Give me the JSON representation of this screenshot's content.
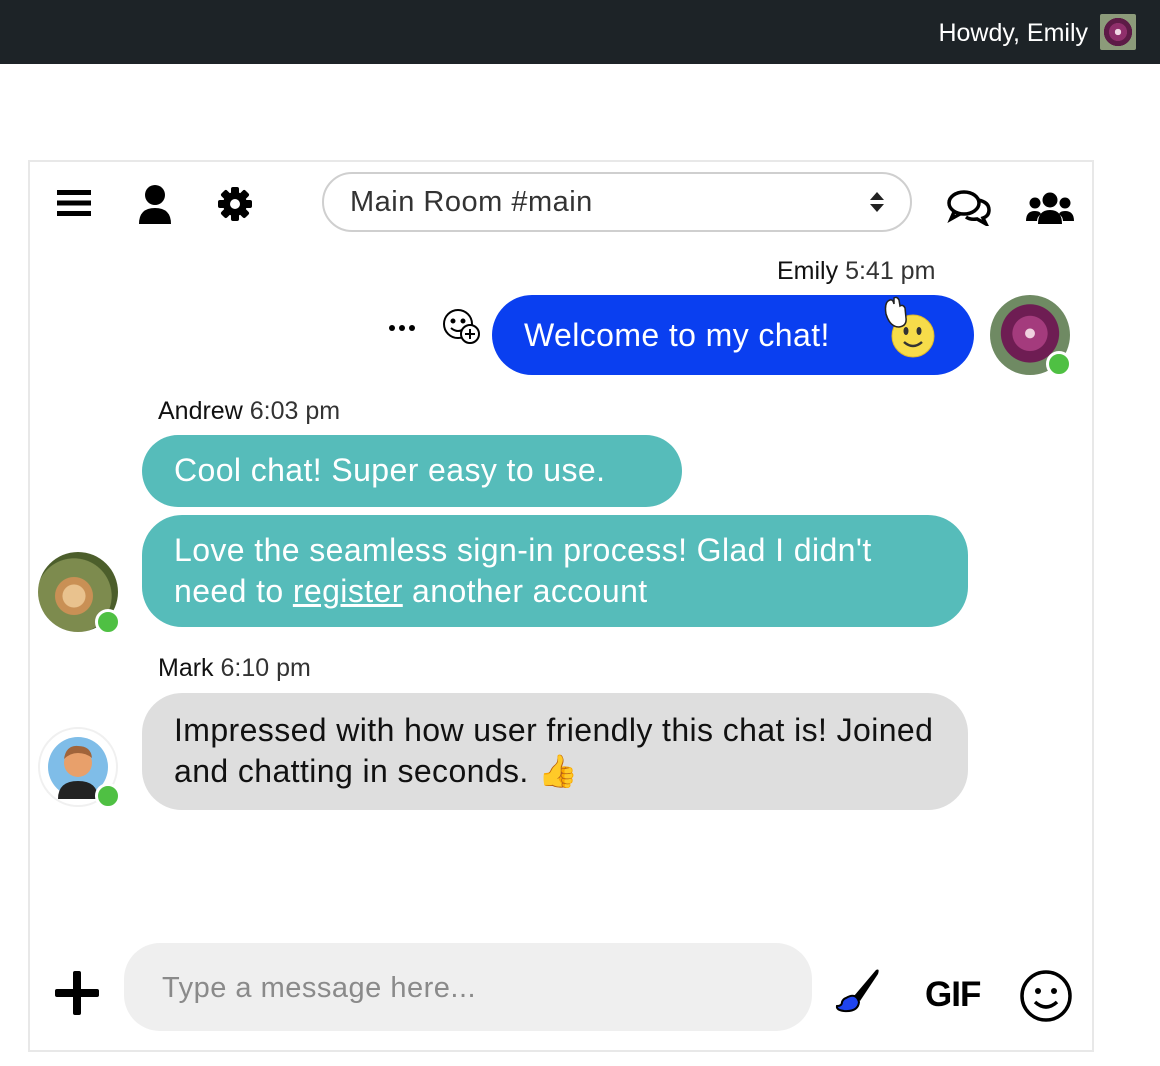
{
  "topbar": {
    "greeting": "Howdy, Emily"
  },
  "header": {
    "room_name": "Main Room #main"
  },
  "messages": [
    {
      "author": "Emily",
      "time": "5:41 pm",
      "text": "Welcome to my chat!",
      "emoji": "wave-smiley",
      "own": true
    },
    {
      "author": "Andrew",
      "time": "6:03 pm",
      "text": "Cool chat! Super easy to use."
    },
    {
      "author": "Andrew",
      "text_before": "Love the seamless sign-in process! Glad I didn't need to ",
      "link": "register",
      "text_after": " another account"
    },
    {
      "author": "Mark",
      "time": "6:10 pm",
      "text": "Impressed with how user friendly this chat is! Joined and chatting in seconds.",
      "emoji": "👍"
    }
  ],
  "composer": {
    "placeholder": "Type a message here...",
    "gif_label": "GIF"
  },
  "colors": {
    "own_bubble": "#0a3ff0",
    "andrew_bubble": "#56bcba",
    "mark_bubble": "#dedede",
    "online": "#4fc043",
    "topbar": "#1d2327"
  }
}
